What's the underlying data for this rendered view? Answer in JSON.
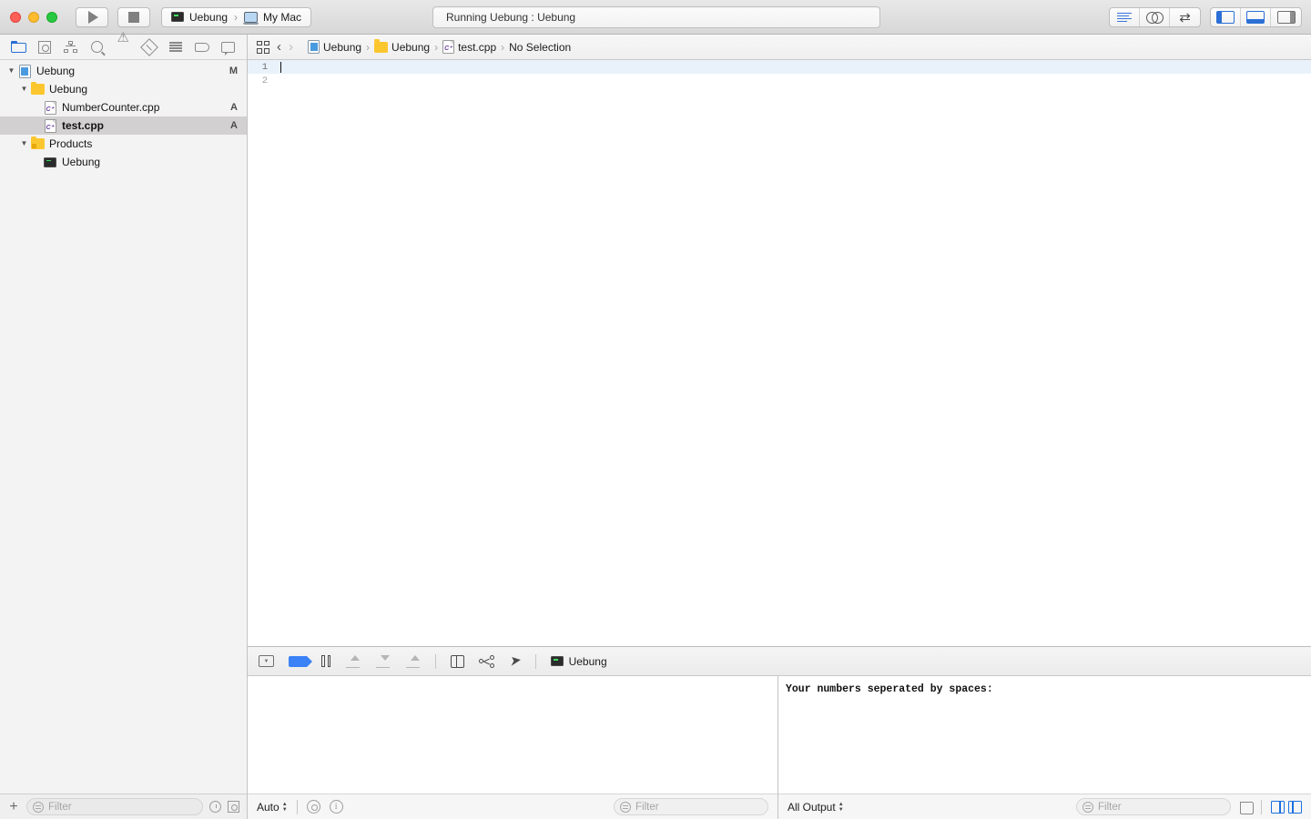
{
  "window": {
    "status_text": "Running Uebung : Uebung",
    "traffic": {
      "close": "close-button",
      "minimize": "minimize-button",
      "zoom": "zoom-button"
    },
    "colors": {
      "accent_blue": "#2b6fd6",
      "breakpoint_blue": "#3b82f6",
      "folder_yellow": "#fcc72e",
      "close_red": "#ff5f57",
      "minimize_yellow": "#febc2e",
      "zoom_green": "#28c840",
      "current_line": "#e9f2fb",
      "selected_row": "#d2d0d0"
    }
  },
  "toolbar": {
    "run_label": "Run",
    "stop_label": "Stop",
    "scheme": {
      "target": "Uebung",
      "separator": "›",
      "destination": "My Mac"
    },
    "editor_modes": [
      {
        "name": "standard-editor",
        "icon": "lines-icon",
        "active": true
      },
      {
        "name": "assistant-editor",
        "icon": "venn-icon",
        "active": false
      },
      {
        "name": "version-editor",
        "icon": "arrows-icon",
        "active": false
      }
    ],
    "view_toggles": [
      {
        "name": "navigator-toggle",
        "icon": "pane-left-icon",
        "active": true
      },
      {
        "name": "debug-area-toggle",
        "icon": "pane-bottom-icon",
        "active": true
      },
      {
        "name": "inspector-toggle",
        "icon": "pane-right-icon",
        "active": false
      }
    ]
  },
  "navigator": {
    "tabs": [
      {
        "name": "project-navigator",
        "icon": "folder-icon",
        "active": true
      },
      {
        "name": "source-control-navigator",
        "icon": "source-control-icon",
        "active": false
      },
      {
        "name": "symbol-navigator",
        "icon": "hierarchy-icon",
        "active": false
      },
      {
        "name": "find-navigator",
        "icon": "search-icon",
        "active": false
      },
      {
        "name": "issue-navigator",
        "icon": "warning-icon",
        "active": false
      },
      {
        "name": "test-navigator",
        "icon": "no-entry-icon",
        "active": false
      },
      {
        "name": "debug-navigator",
        "icon": "rows-icon",
        "active": false
      },
      {
        "name": "breakpoint-navigator",
        "icon": "tag-icon",
        "active": false
      },
      {
        "name": "report-navigator",
        "icon": "bubble-icon",
        "active": false
      }
    ],
    "tree": [
      {
        "label": "Uebung",
        "icon": "project-icon",
        "badge": "M",
        "depth": 0,
        "disclosure": "▼",
        "selected": false
      },
      {
        "label": "Uebung",
        "icon": "folder-icon",
        "badge": "",
        "depth": 1,
        "disclosure": "▼",
        "selected": false
      },
      {
        "label": "NumberCounter.cpp",
        "icon": "cpp-file-icon",
        "badge": "A",
        "depth": 2,
        "disclosure": "",
        "selected": false
      },
      {
        "label": "test.cpp",
        "icon": "cpp-file-icon",
        "badge": "A",
        "depth": 2,
        "disclosure": "",
        "selected": true
      },
      {
        "label": "Products",
        "icon": "products-folder-icon",
        "badge": "",
        "depth": 1,
        "disclosure": "▼",
        "selected": false
      },
      {
        "label": "Uebung",
        "icon": "executable-icon",
        "badge": "",
        "depth": 2,
        "disclosure": "",
        "selected": false
      }
    ],
    "footer": {
      "add_label": "+",
      "filter_placeholder": "Filter",
      "recent_icon": "clock-icon",
      "source_control_icon": "source-control-filter-icon"
    }
  },
  "jumpbar": {
    "related_items_icon": "grid-icon",
    "back_label": "‹",
    "forward_label": "›",
    "breadcrumbs": [
      {
        "label": "Uebung",
        "icon": "project-icon"
      },
      {
        "label": "Uebung",
        "icon": "folder-icon"
      },
      {
        "label": "test.cpp",
        "icon": "cpp-file-icon"
      },
      {
        "label": "No Selection",
        "icon": ""
      }
    ],
    "separator": "›"
  },
  "editor": {
    "lines": [
      {
        "number": "1",
        "text": "",
        "current": true
      },
      {
        "number": "2",
        "text": "",
        "current": false
      }
    ]
  },
  "debug_bar": {
    "buttons": [
      {
        "name": "hide-debug-area-button",
        "icon": "hide-pane-icon",
        "active": false
      },
      {
        "name": "deactivate-breakpoints-button",
        "icon": "breakpoint-icon",
        "active": true
      },
      {
        "name": "pause-button",
        "icon": "pause-icon",
        "active": false
      },
      {
        "name": "step-over-button",
        "icon": "step-over-icon",
        "active": false
      },
      {
        "name": "step-into-button",
        "icon": "step-into-icon",
        "active": false
      },
      {
        "name": "step-out-button",
        "icon": "step-out-icon",
        "active": false
      },
      {
        "name": "view-hierarchy-button",
        "icon": "view-hierarchy-icon",
        "active": false
      },
      {
        "name": "memory-graph-button",
        "icon": "memory-graph-icon",
        "active": false
      },
      {
        "name": "simulate-location-button",
        "icon": "location-arrow-icon",
        "active": false
      }
    ],
    "process_label": "Uebung",
    "process_icon": "executable-icon"
  },
  "variables_pane": {
    "scope_label": "Auto",
    "watch_icon": "eye-icon",
    "info_icon": "info-icon",
    "filter_placeholder": "Filter"
  },
  "console_pane": {
    "output_lines": [
      "Your numbers seperated by spaces:"
    ],
    "output_scope_label": "All Output",
    "filter_placeholder": "Filter",
    "clear_icon": "trash-icon",
    "split_left_icon": "show-variables-icon",
    "split_right_icon": "show-console-icon"
  }
}
